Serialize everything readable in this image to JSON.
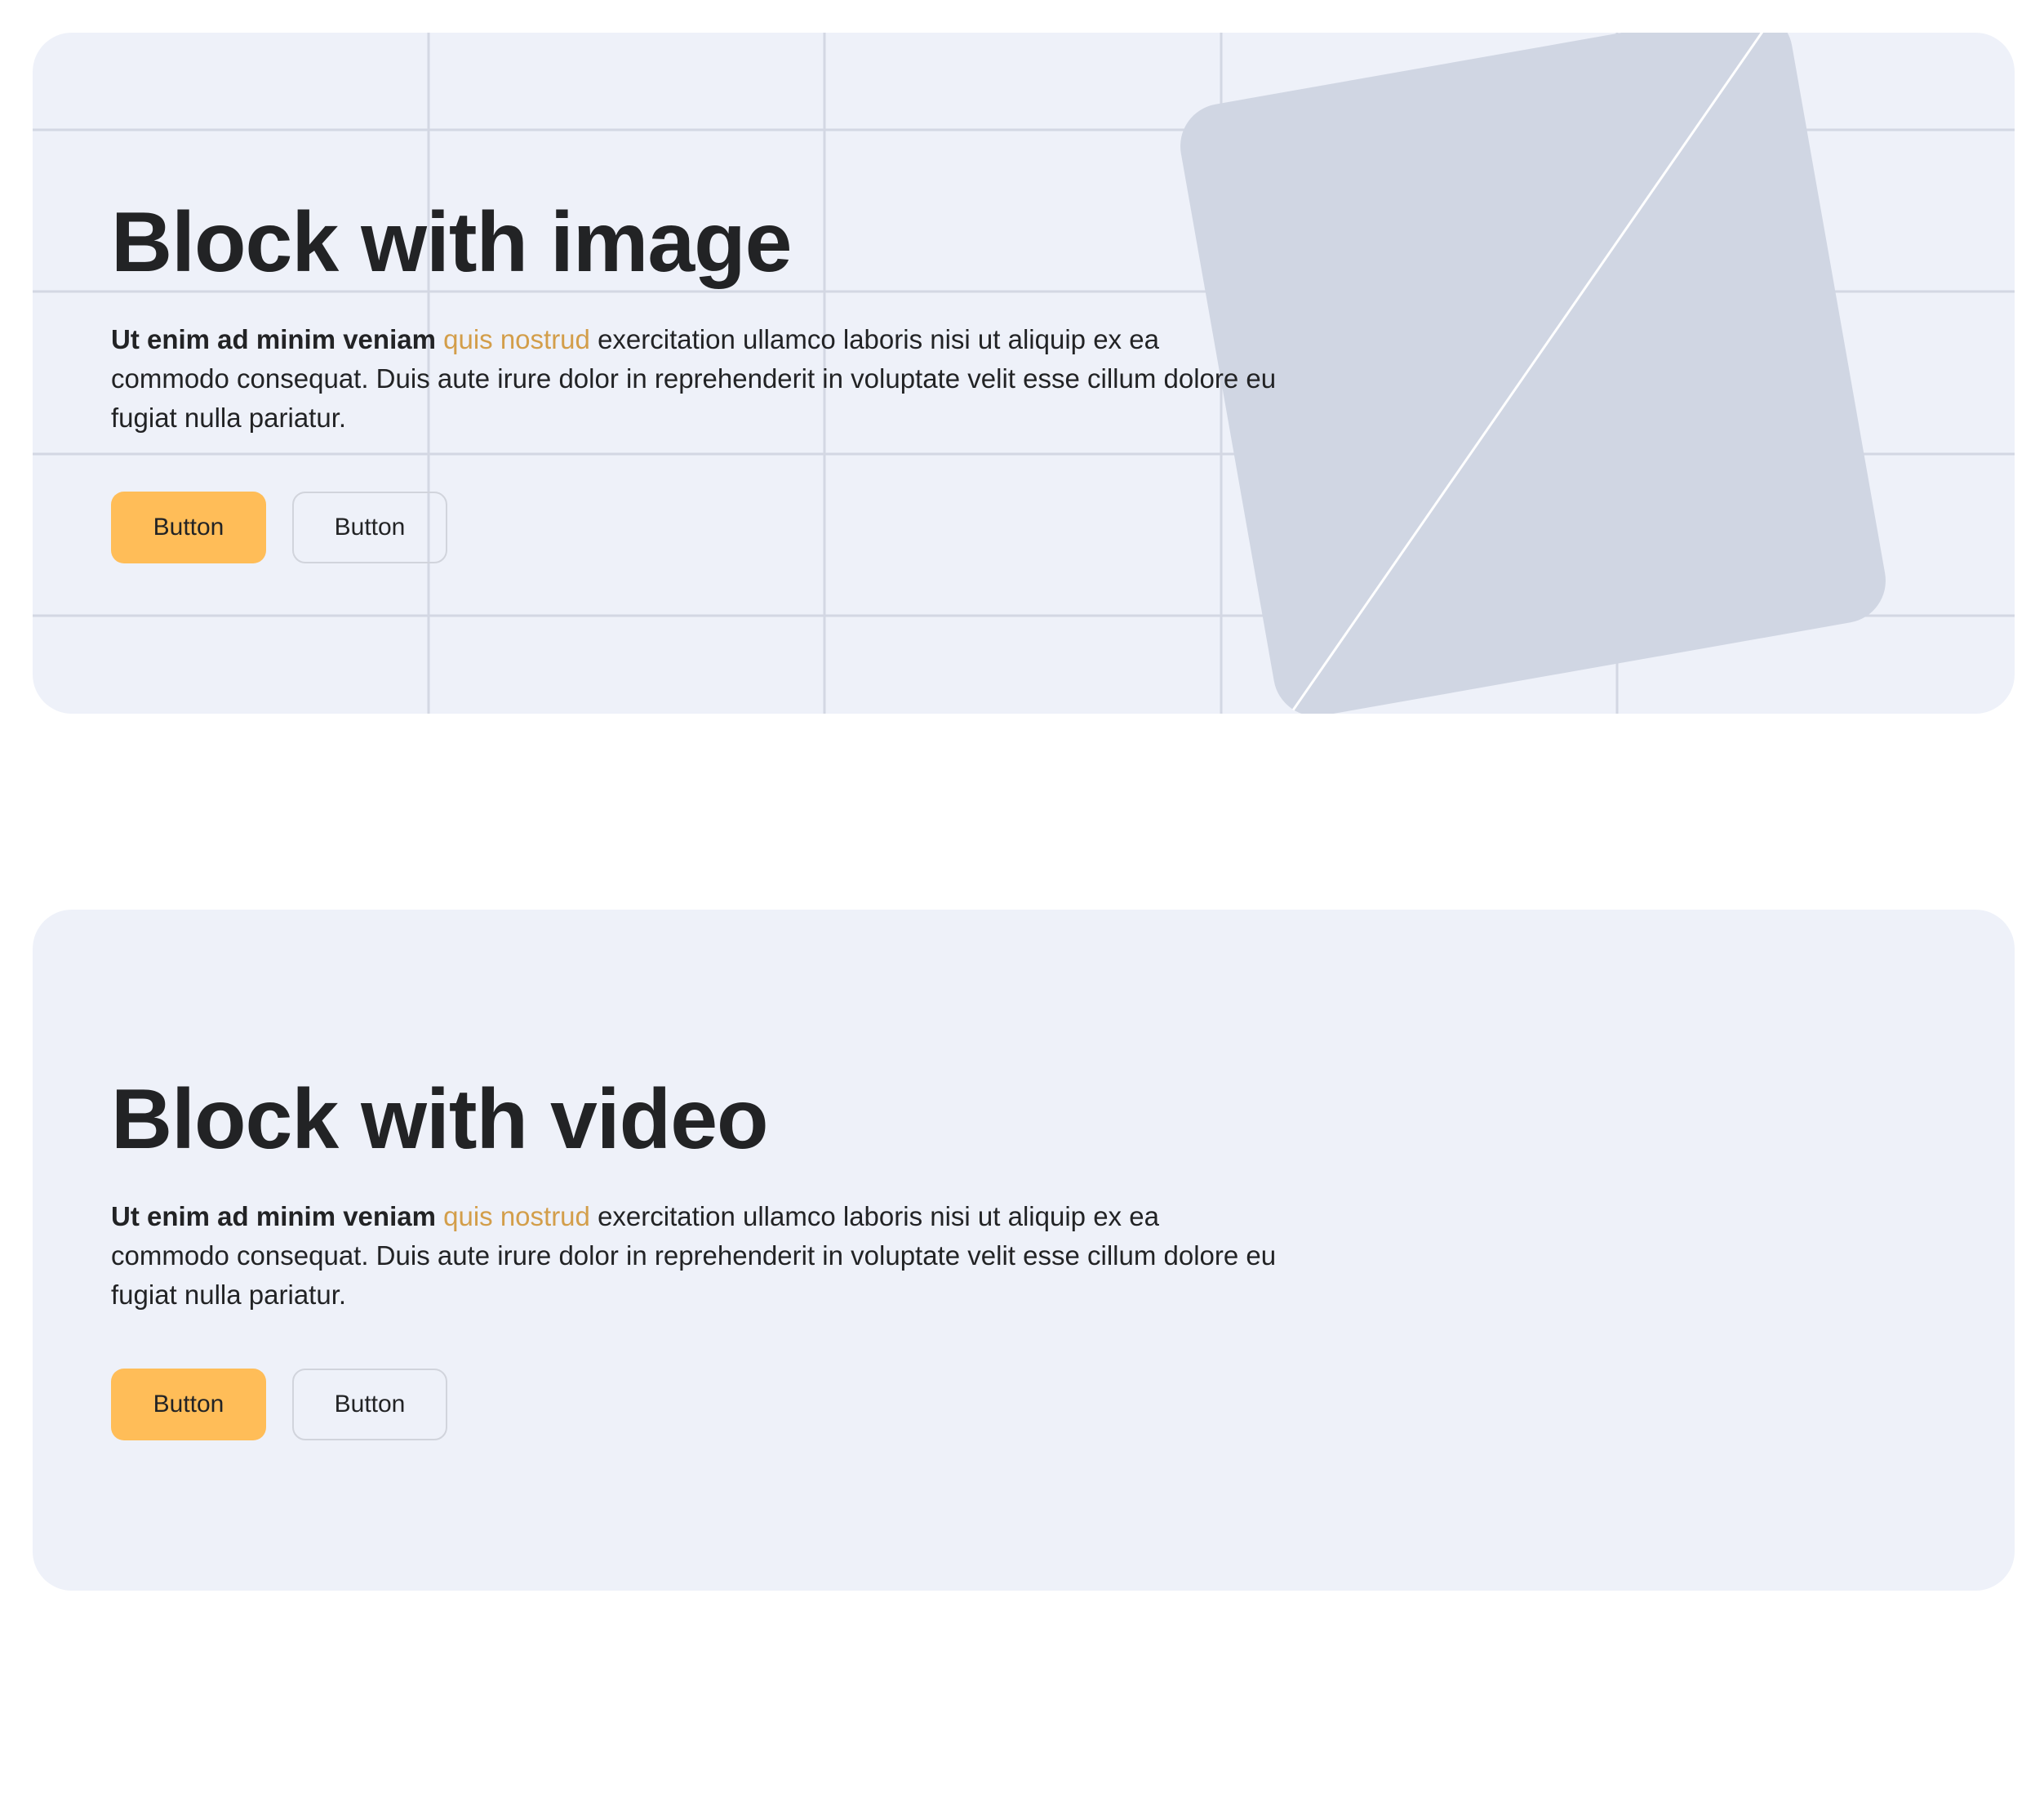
{
  "blocks": [
    {
      "title": "Block with image",
      "text": {
        "bold": "Ut enim ad minim veniam",
        "accent": "quis nostrud",
        "rest": "exercitation ullamco laboris nisi ut aliquip ex ea commodo consequat. Duis aute irure dolor in reprehenderit in voluptate velit esse cillum dolore eu fugiat nulla pariatur."
      },
      "buttons": {
        "primary_label": "Button",
        "secondary_label": "Button"
      }
    },
    {
      "title": "Block with video",
      "text": {
        "bold": "Ut enim ad minim veniam",
        "accent": "quis nostrud",
        "rest": "exercitation ullamco laboris nisi ut aliquip ex ea commodo consequat. Duis aute irure dolor in reprehenderit in voluptate velit esse cillum dolore eu fugiat nulla pariatur."
      },
      "buttons": {
        "primary_label": "Button",
        "secondary_label": "Button"
      }
    }
  ],
  "colors": {
    "block_background": "#eef1f9",
    "accent_text": "#d39e4a",
    "primary_button": "#ffbd58",
    "grid_line": "#d3d7e3",
    "image_placeholder": "#d0d6e3"
  },
  "icons": {
    "image_placeholder": "image-placeholder-icon"
  }
}
